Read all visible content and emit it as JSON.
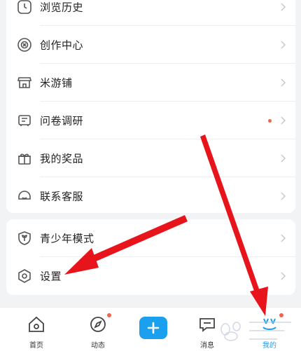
{
  "menu_top": [
    {
      "label": "浏览历史",
      "icon": "clock-icon",
      "badge": false
    },
    {
      "label": "创作中心",
      "icon": "creation-badge-icon",
      "badge": false
    },
    {
      "label": "米游铺",
      "icon": "shop-icon",
      "badge": false
    },
    {
      "label": "问卷调研",
      "icon": "survey-icon",
      "badge": true
    },
    {
      "label": "我的奖品",
      "icon": "gift-icon",
      "badge": false
    },
    {
      "label": "联系客服",
      "icon": "customer-service-icon",
      "badge": false
    }
  ],
  "menu_bottom": [
    {
      "label": "青少年模式",
      "icon": "teen-mode-shield-icon"
    },
    {
      "label": "设置",
      "icon": "settings-hexagon-icon"
    }
  ],
  "tabbar": {
    "home": "首页",
    "feed": "动态",
    "messages": "消息",
    "me": "我的",
    "active": "me"
  },
  "colors": {
    "accent": "#1aa0ef",
    "badge": "#f2644a",
    "annotation_arrow": "#e8141c",
    "text": "#222222",
    "icon": "#555555",
    "chevron": "#c8c8c8"
  }
}
